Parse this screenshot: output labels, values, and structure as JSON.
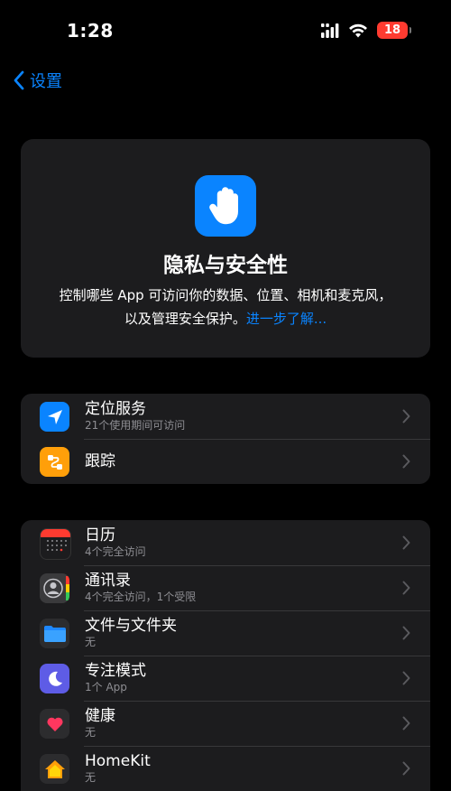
{
  "status_bar": {
    "time": "1:28",
    "battery_level": "18",
    "icons": [
      "signal-icon",
      "wifi-icon",
      "battery-icon"
    ]
  },
  "nav": {
    "back_label": "设置"
  },
  "header": {
    "icon": "hand-raised-icon",
    "title": "隐私与安全性",
    "description": "控制哪些 App 可访问你的数据、位置、相机和麦克风，以及管理安全保护。",
    "learn_more": "进一步了解..."
  },
  "group1": [
    {
      "title": "定位服务",
      "subtitle": "21个使用期间可访问",
      "icon": "location-arrow-icon",
      "color": "#0a84ff"
    },
    {
      "title": "跟踪",
      "subtitle": "",
      "icon": "tracking-icon",
      "color": "#ff9f0a"
    }
  ],
  "group2": [
    {
      "title": "日历",
      "subtitle": "4个完全访问",
      "icon": "calendar-icon"
    },
    {
      "title": "通讯录",
      "subtitle": "4个完全访问，1个受限",
      "icon": "contacts-icon"
    },
    {
      "title": "文件与文件夹",
      "subtitle": "无",
      "icon": "folder-icon"
    },
    {
      "title": "专注模式",
      "subtitle": "1个 App",
      "icon": "moon-icon"
    },
    {
      "title": "健康",
      "subtitle": "无",
      "icon": "heart-icon"
    },
    {
      "title": "HomeKit",
      "subtitle": "无",
      "icon": "home-icon"
    }
  ],
  "colors": {
    "accent": "#0a84ff",
    "background": "#000000",
    "card": "#1c1c1e",
    "secondary_text": "#8e8e93"
  }
}
